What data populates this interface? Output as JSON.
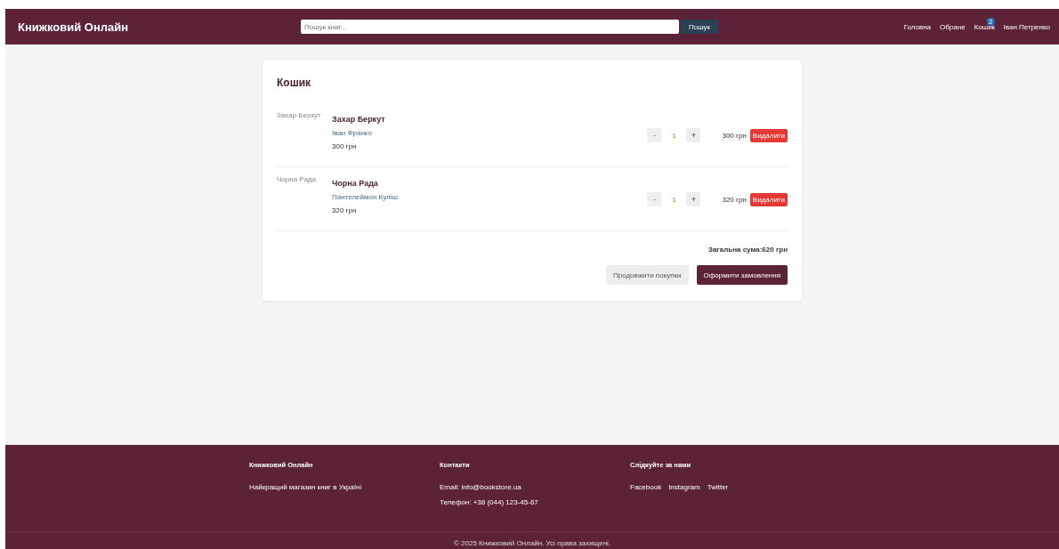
{
  "header": {
    "logo": "Книжковий Онлайн",
    "search": {
      "placeholder": "Пошук книг...",
      "button": "Пошук"
    },
    "nav": [
      {
        "label": "Головна"
      },
      {
        "label": "Обране"
      },
      {
        "label": "Кошик",
        "badge": "2"
      },
      {
        "label": "Іван Петренко"
      }
    ]
  },
  "cart": {
    "title": "Кошик",
    "items": [
      {
        "image_alt": "Захар Беркут",
        "title": "Захар Беркут",
        "author": "Іван Франко",
        "price": "300 грн",
        "minus": "-",
        "quantity": "1",
        "plus": "+",
        "line_total": "300 грн",
        "remove": "Видалити"
      },
      {
        "image_alt": "Чорна Рада",
        "title": "Чорна Рада",
        "author": "Пантелеймон Куліш",
        "price": "320 грн",
        "minus": "-",
        "quantity": "1",
        "plus": "+",
        "line_total": "320 грн",
        "remove": "Видалити"
      }
    ],
    "total": "Загальна сума:620 грн",
    "continue_button": "Продовжити покупки",
    "checkout_button": "Оформити замовлення"
  },
  "footer": {
    "columns": [
      {
        "title": "Книжковий Онлайн",
        "lines": [
          "Найкращий магазин книг в Україні"
        ]
      },
      {
        "title": "Контакти",
        "lines": [
          "Email: info@bookstore.ua",
          "Телефон: +38 (044) 123-45-67"
        ]
      },
      {
        "title": "Слідкуйте за нами",
        "links": [
          "Facebook",
          "Instagram",
          "Twitter"
        ]
      }
    ],
    "copyright": "© 2025 Книжковий Онлайн. Усі права захищені."
  }
}
